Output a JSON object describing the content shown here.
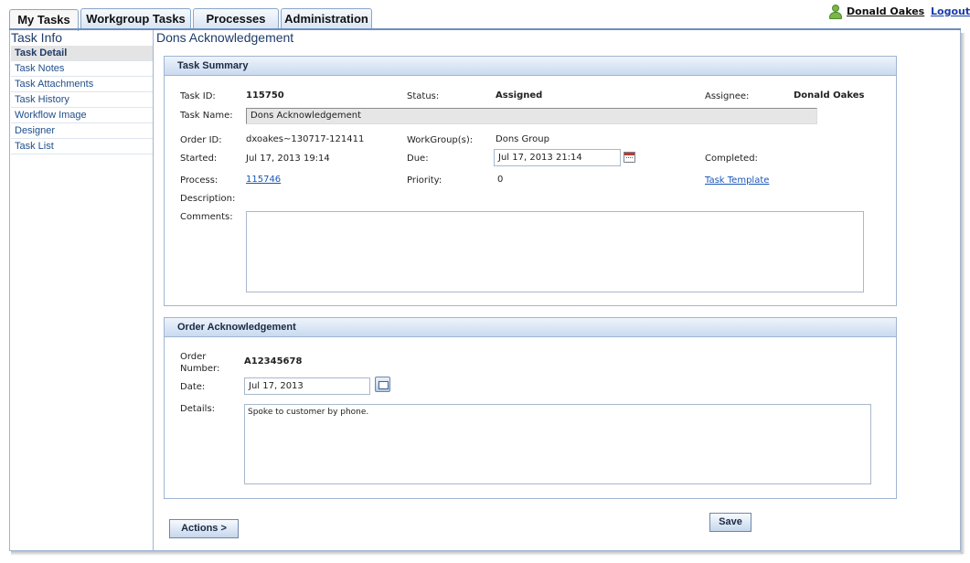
{
  "tabs": [
    {
      "label": "My Tasks"
    },
    {
      "label": "Workgroup Tasks"
    },
    {
      "label": "Processes"
    },
    {
      "label": "Administration"
    }
  ],
  "user": {
    "name": "Donald Oakes",
    "logout_label": "Logout"
  },
  "sidebar": {
    "title": "Task Info",
    "items": [
      {
        "label": "Task Detail"
      },
      {
        "label": "Task Notes"
      },
      {
        "label": "Task Attachments"
      },
      {
        "label": "Task History"
      },
      {
        "label": "Workflow Image"
      },
      {
        "label": "Designer"
      },
      {
        "label": "Task List"
      }
    ]
  },
  "page_title": "Dons Acknowledgement",
  "task_summary": {
    "heading": "Task Summary",
    "task_id_label": "Task ID:",
    "task_id": "115750",
    "status_label": "Status:",
    "status": "Assigned",
    "assignee_label": "Assignee:",
    "assignee": "Donald Oakes",
    "task_name_label": "Task Name:",
    "task_name": "Dons Acknowledgement",
    "order_id_label": "Order ID:",
    "order_id": "dxoakes~130717-121411",
    "workgroups_label": "WorkGroup(s):",
    "workgroups": "Dons Group",
    "started_label": "Started:",
    "started": "Jul 17, 2013 19:14",
    "due_label": "Due:",
    "due": "Jul 17, 2013 21:14",
    "completed_label": "Completed:",
    "process_label": "Process:",
    "process": "115746",
    "priority_label": "Priority:",
    "priority": "0",
    "template_link": "Task Template",
    "description_label": "Description:",
    "comments_label": "Comments:",
    "comments": ""
  },
  "order_ack": {
    "heading": "Order Acknowledgement",
    "order_number_label_1": "Order",
    "order_number_label_2": "Number:",
    "order_number": "A12345678",
    "date_label": "Date:",
    "date": "Jul 17, 2013",
    "details_label": "Details:",
    "details": "Spoke to customer by phone."
  },
  "buttons": {
    "actions": "Actions >",
    "save": "Save"
  }
}
